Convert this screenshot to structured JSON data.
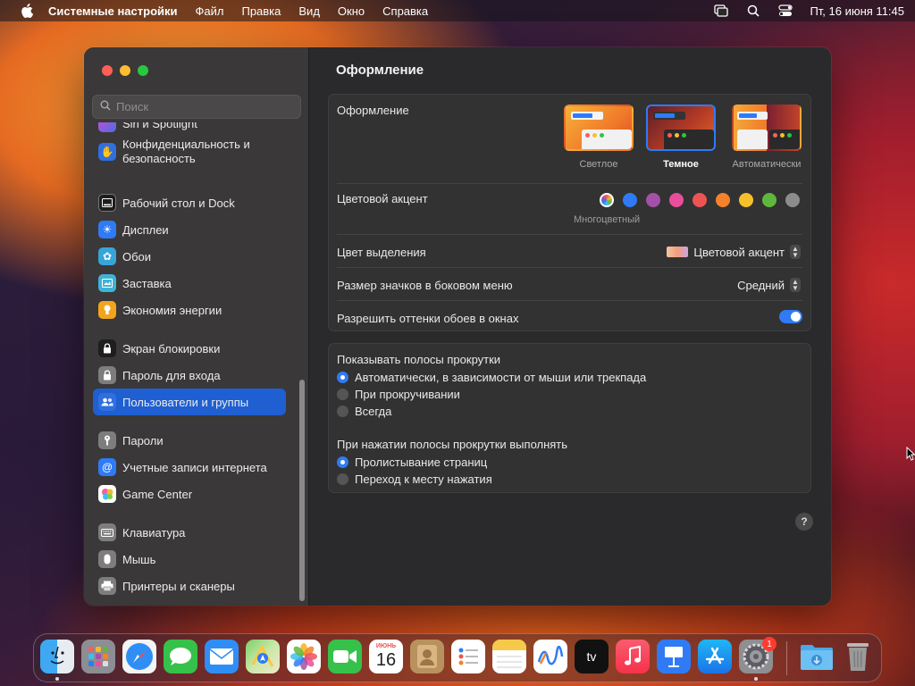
{
  "menubar": {
    "app_name": "Системные настройки",
    "items": [
      "Файл",
      "Правка",
      "Вид",
      "Окно",
      "Справка"
    ],
    "datetime": "Пт, 16 июня  11:45"
  },
  "sidebar": {
    "search_placeholder": "Поиск",
    "items": [
      {
        "label": "Siri и Spotlight",
        "icon": "siri-icon",
        "color": "#8e4be0"
      },
      {
        "label": "Конфиденциальность и безопасность",
        "line1": "Конфиденциальность и",
        "line2": "безопасность",
        "icon": "hand-icon",
        "color": "#2f6fe0"
      },
      {
        "label": "Рабочий стол и Dock",
        "icon": "dock-icon",
        "color": "#2b2b2b"
      },
      {
        "label": "Дисплеи",
        "icon": "sun-icon",
        "color": "#2f7bf6"
      },
      {
        "label": "Обои",
        "icon": "flower-icon",
        "color": "#36a5d8"
      },
      {
        "label": "Заставка",
        "icon": "screensaver-icon",
        "color": "#3fb3d6"
      },
      {
        "label": "Экономия энергии",
        "icon": "bulb-icon",
        "color": "#f2a51c"
      },
      {
        "label": "Экран блокировки",
        "icon": "lock-icon",
        "color": "#2b2b2b"
      },
      {
        "label": "Пароль для входа",
        "icon": "padlock-icon",
        "color": "#7d7d7d"
      },
      {
        "label": "Пользователи и группы",
        "icon": "users-icon",
        "color": "#2f6fe0"
      },
      {
        "label": "Пароли",
        "icon": "key-icon",
        "color": "#7d7d7d"
      },
      {
        "label": "Учетные записи интернета",
        "icon": "at-icon",
        "color": "#2f7bf6"
      },
      {
        "label": "Game Center",
        "icon": "gamecenter-icon",
        "color": "#ffffff"
      },
      {
        "label": "Клавиатура",
        "icon": "keyboard-icon",
        "color": "#7d7d7d"
      },
      {
        "label": "Мышь",
        "icon": "mouse-icon",
        "color": "#7d7d7d"
      },
      {
        "label": "Принтеры и сканеры",
        "icon": "printer-icon",
        "color": "#7d7d7d"
      }
    ],
    "selected": "Пользователи и группы"
  },
  "content": {
    "title": "Оформление",
    "appearance": {
      "label": "Оформление",
      "options": [
        {
          "label": "Светлое",
          "selected": false
        },
        {
          "label": "Темное",
          "selected": true
        },
        {
          "label": "Автоматически",
          "selected": false
        }
      ]
    },
    "accent": {
      "label": "Цветовой акцент",
      "colors": [
        "multicolor",
        "#2f7bf6",
        "#a550a7",
        "#e94e9a",
        "#ec5454",
        "#f5822a",
        "#f6c02b",
        "#5fb83e",
        "#8c8c8c"
      ],
      "caption": "Многоцветный"
    },
    "highlight": {
      "label": "Цвет выделения",
      "value": "Цветовой акцент"
    },
    "sidebar_icon_size": {
      "label": "Размер значков в боковом меню",
      "value": "Средний"
    },
    "wallpaper_tint": {
      "label": "Разрешить оттенки обоев в окнах",
      "enabled": true
    },
    "show_scrollbars": {
      "label": "Показывать полосы прокрутки",
      "options": [
        "Автоматически, в зависимости от мыши или трекпада",
        "При прокручивании",
        "Всегда"
      ],
      "selected": 0
    },
    "click_scrollbar": {
      "label": "При нажатии полосы прокрутки выполнять",
      "options": [
        "Пролистывание страниц",
        "Переход к месту нажатия"
      ],
      "selected": 0
    },
    "help": "?"
  },
  "dock": {
    "apps": [
      {
        "name": "Finder",
        "icon": "finder-icon",
        "running": true
      },
      {
        "name": "Launchpad",
        "icon": "launchpad-icon"
      },
      {
        "name": "Safari",
        "icon": "safari-icon"
      },
      {
        "name": "Сообщения",
        "icon": "messages-icon"
      },
      {
        "name": "Почта",
        "icon": "mail-icon"
      },
      {
        "name": "Карты",
        "icon": "maps-icon"
      },
      {
        "name": "Фото",
        "icon": "photos-icon"
      },
      {
        "name": "FaceTime",
        "icon": "facetime-icon"
      },
      {
        "name": "Календарь",
        "icon": "calendar-icon",
        "month": "ИЮНЬ",
        "day": "16"
      },
      {
        "name": "Контакты",
        "icon": "contacts-icon"
      },
      {
        "name": "Напоминания",
        "icon": "reminders-icon"
      },
      {
        "name": "Заметки",
        "icon": "notes-icon"
      },
      {
        "name": "Freeform",
        "icon": "freeform-icon"
      },
      {
        "name": "TV",
        "icon": "appletv-icon",
        "label": "tv"
      },
      {
        "name": "Музыка",
        "icon": "music-icon"
      },
      {
        "name": "Keynote",
        "icon": "keynote-icon"
      },
      {
        "name": "App Store",
        "icon": "appstore-icon"
      },
      {
        "name": "Системные настройки",
        "icon": "settings-icon",
        "badge": "1",
        "running": true
      },
      {
        "name": "Загрузки",
        "icon": "downloads-folder-icon"
      },
      {
        "name": "Корзина",
        "icon": "trash-icon"
      }
    ]
  }
}
